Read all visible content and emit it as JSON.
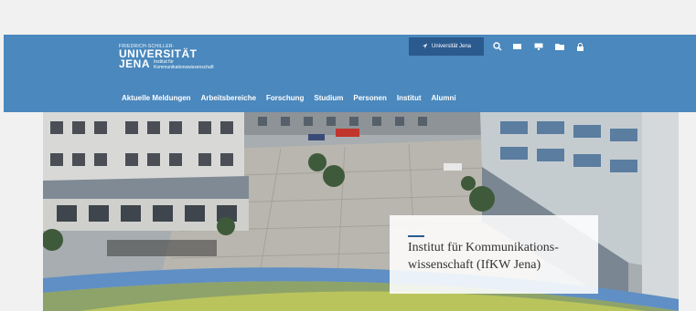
{
  "header": {
    "logo_small": "FRIEDRICH-SCHILLER-",
    "logo_uni": "UNIVERSITÄT",
    "logo_jena": "JENA",
    "logo_inst": "Institut für\nKommunikationswissenschaft",
    "uni_button": "Universität Jena",
    "tools": [
      "search-icon",
      "language-icon",
      "monitor-icon",
      "folder-icon",
      "lock-icon"
    ],
    "nav": [
      "Aktuelle Meldungen",
      "Arbeitsbereiche",
      "Forschung",
      "Studium",
      "Personen",
      "Institut",
      "Alumni"
    ]
  },
  "hero": {
    "caption": "Institut für Kommunikations-wissenschaft (IfKW Jena)"
  },
  "colors": {
    "header_bg": "#4a88bd",
    "button_bg": "#2b5a8f"
  }
}
